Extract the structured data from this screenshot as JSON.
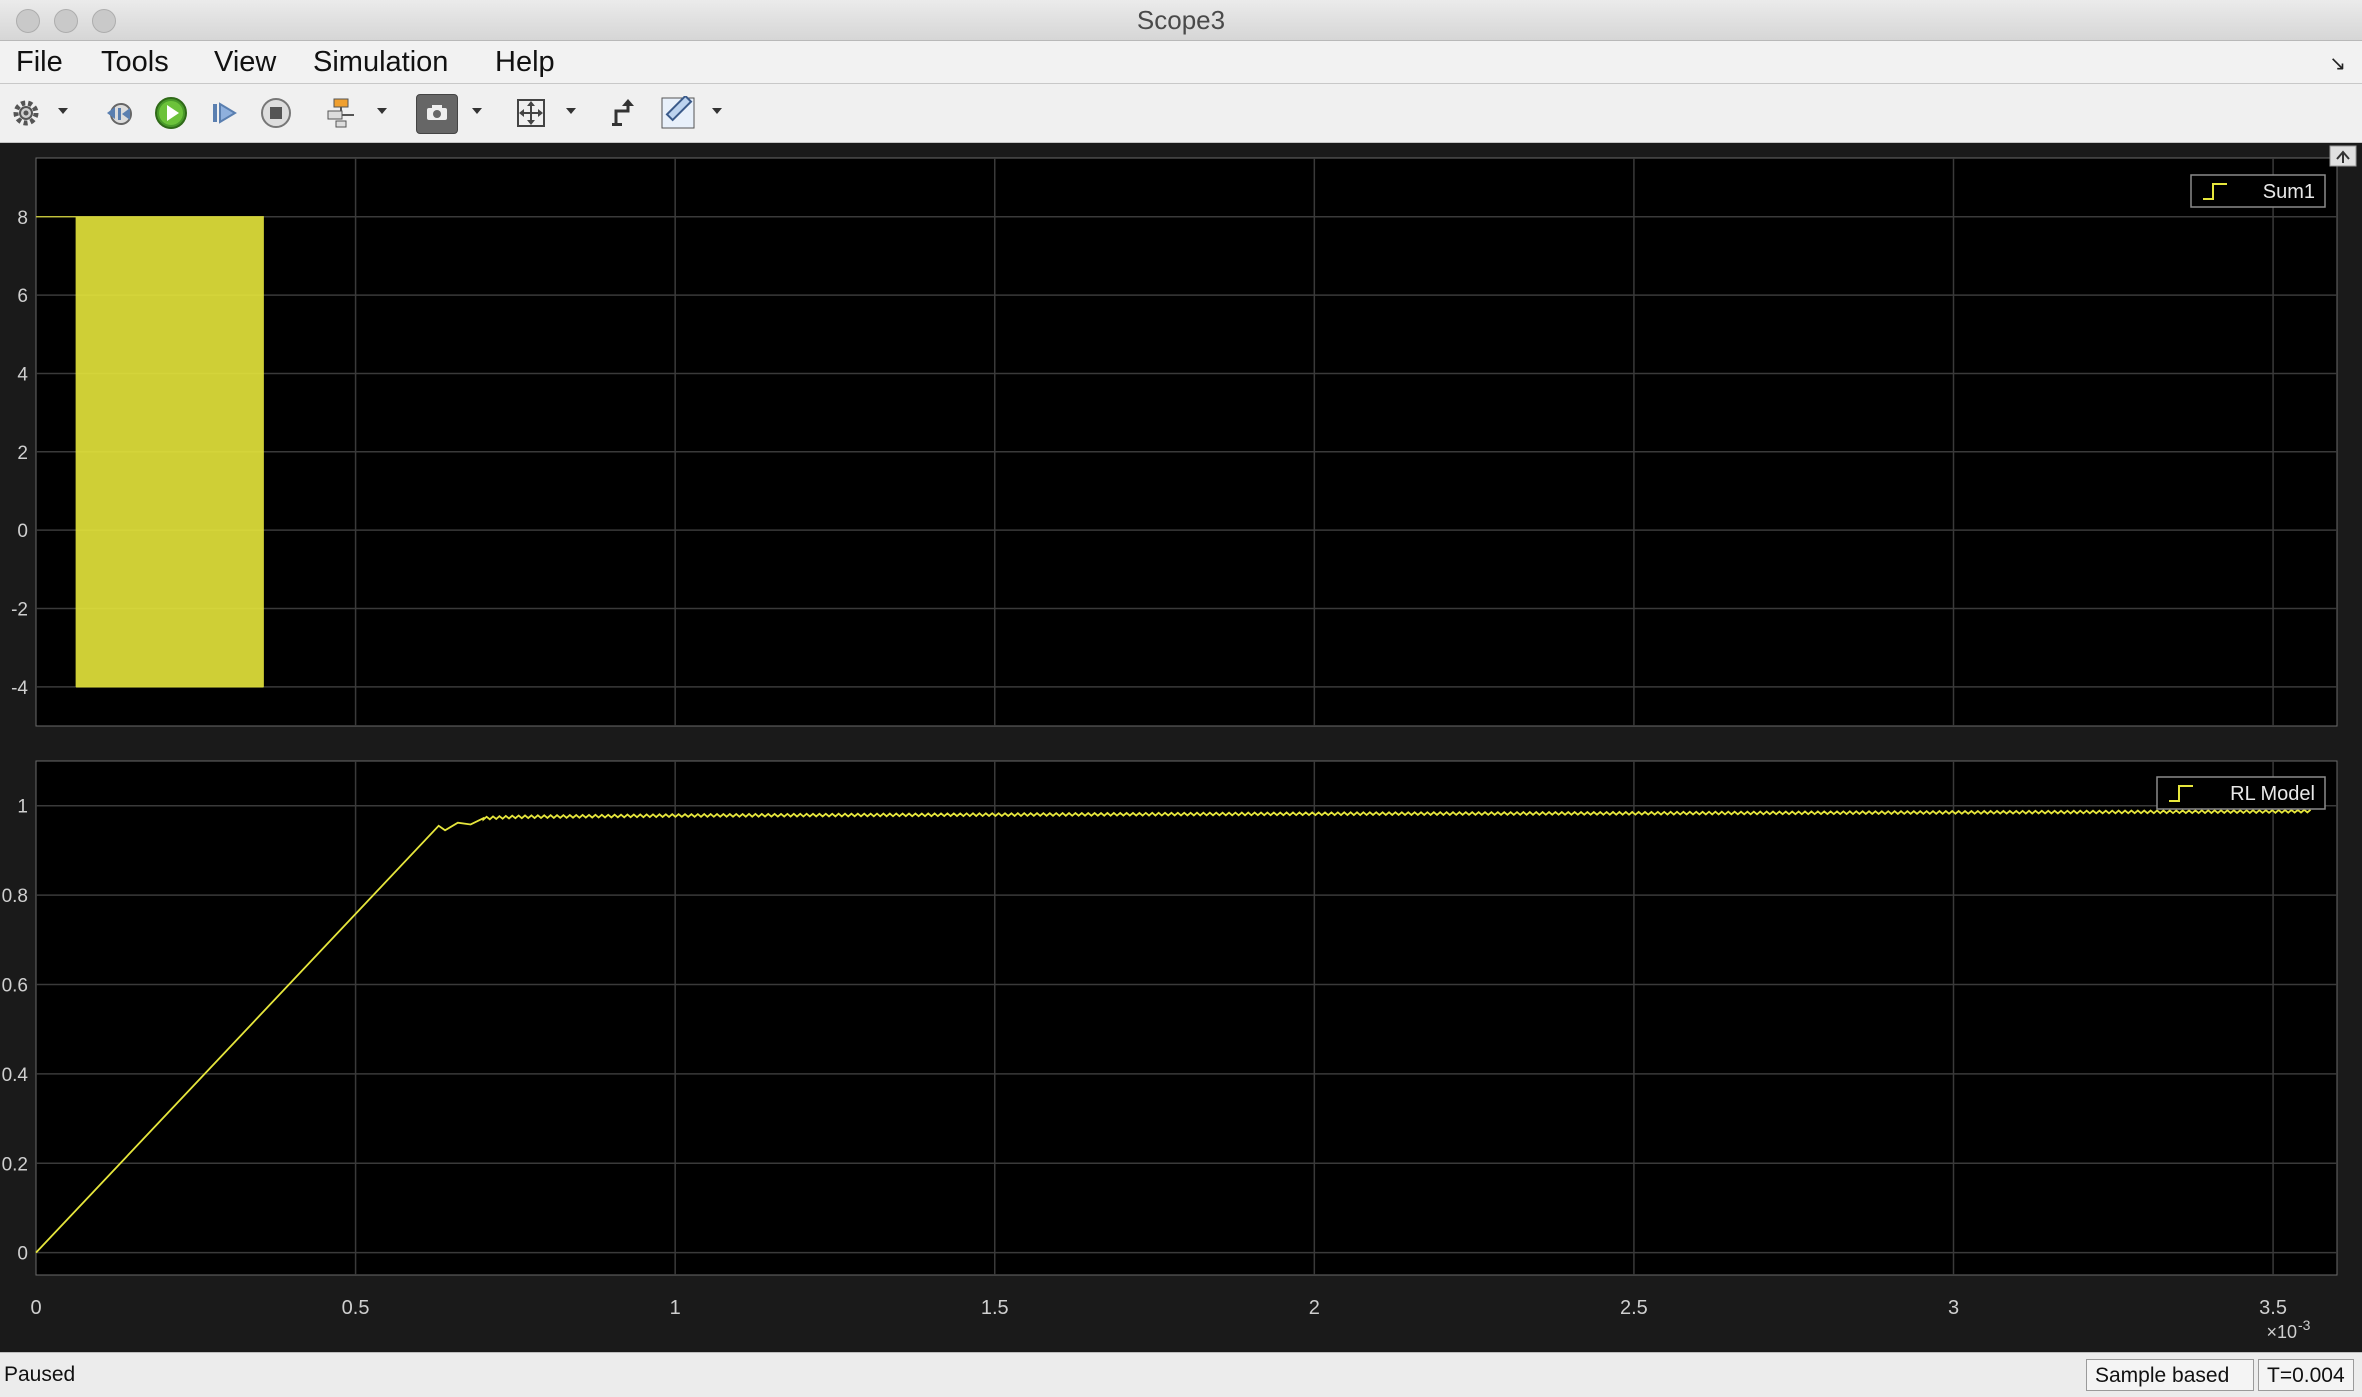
{
  "window": {
    "title": "Scope3"
  },
  "menu": [
    "File",
    "Tools",
    "View",
    "Simulation",
    "Help"
  ],
  "toolbar": {
    "buttons": [
      "gear-icon",
      "step-back-icon",
      "run-icon",
      "step-forward-icon",
      "stop-icon",
      "signal-selector-icon",
      "highlight-icon",
      "zoom-fit-icon",
      "cursor-icon",
      "measure-icon"
    ]
  },
  "status": {
    "left": "Paused",
    "mode": "Sample based",
    "time": "T=0.004"
  },
  "colors": {
    "signal": "#e6e63c",
    "axes_bg": "#000000",
    "grid": "#3a3a3a",
    "tick_text": "#cfcfcf"
  },
  "chart_data": [
    {
      "type": "line",
      "style": "step",
      "series": [
        {
          "name": "Sum1"
        }
      ],
      "x_range": [
        0,
        0.00036
      ],
      "ylim": [
        -5,
        9.5
      ],
      "y_ticks": [
        -4,
        -2,
        0,
        2,
        4,
        6,
        8
      ],
      "y_tick_labels": [
        "-4",
        "-2",
        "0",
        "2",
        "4",
        "6",
        "8"
      ],
      "legend_position": "top-right",
      "grid": true,
      "signal": {
        "description_values": "PWM switching between 8 and -4",
        "high": 8,
        "low": -4,
        "switching_start": 6.3e-06,
        "switching_end": 3.56e-05,
        "pulse_count": 240
      }
    },
    {
      "type": "line",
      "series": [
        {
          "name": "RL Model"
        }
      ],
      "x": [
        0,
        6.3e-05,
        6.4e-05,
        6.6e-05,
        6.8e-05,
        7e-05,
        7.5e-05,
        0.0001,
        0.00015,
        0.0002,
        0.00025,
        0.0003,
        0.00035,
        0.000356
      ],
      "y": [
        0,
        0.955,
        0.945,
        0.962,
        0.958,
        0.972,
        0.975,
        0.978,
        0.98,
        0.982,
        0.983,
        0.985,
        0.987,
        0.988
      ],
      "ripple_amplitude": 0.006,
      "ylim": [
        -0.05,
        1.1
      ],
      "y_ticks": [
        0,
        0.2,
        0.4,
        0.6,
        0.8,
        1
      ],
      "y_tick_labels": [
        "0",
        "0.2",
        "0.4",
        "0.6",
        "0.8",
        "1"
      ],
      "x_ticks": [
        0,
        0.5,
        1,
        1.5,
        2,
        2.5,
        3,
        3.5
      ],
      "x_tick_labels": [
        "0",
        "0.5",
        "1",
        "1.5",
        "2",
        "2.5",
        "3",
        "3.5"
      ],
      "x_exponent_label": "×10",
      "x_exponent_power": "-3",
      "legend_position": "top-right",
      "grid": true
    }
  ]
}
